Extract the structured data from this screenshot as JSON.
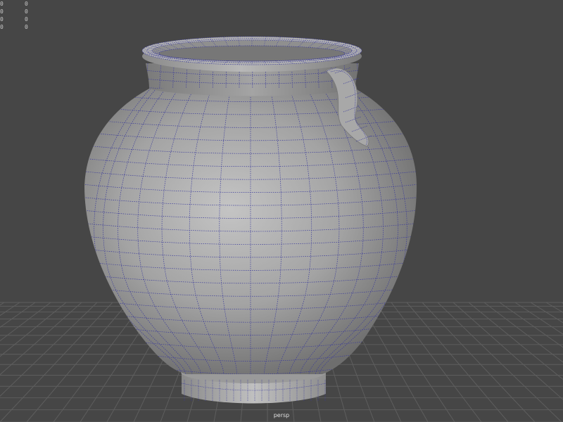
{
  "viewport": {
    "camera_name": "persp",
    "background_color": "#464646",
    "grid_color": "#5e5e5e",
    "wire_color": "#3a3a9a",
    "hud": [
      {
        "label": "0",
        "value": "0"
      },
      {
        "label": "0",
        "value": "0"
      },
      {
        "label": "0",
        "value": "0"
      },
      {
        "label": "0",
        "value": "0"
      }
    ]
  },
  "scene": {
    "object": "vase-mesh",
    "shading": "smooth-shade-with-wireframe",
    "has_ground_grid": true
  }
}
